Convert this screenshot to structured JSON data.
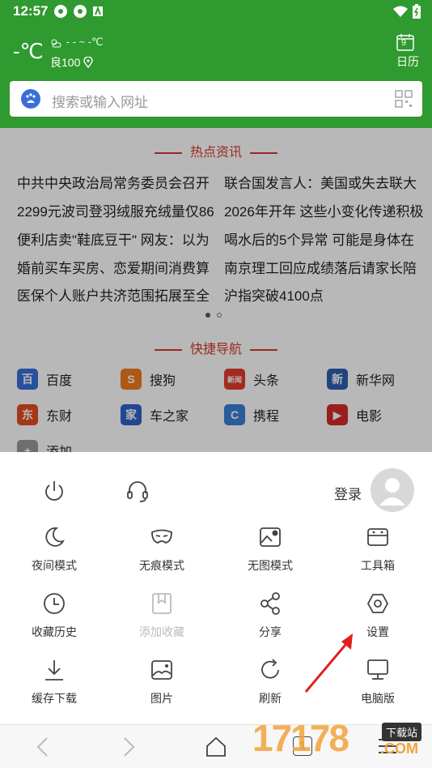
{
  "status_bar": {
    "time": "12:57"
  },
  "weather": {
    "temp": "-℃",
    "detail": "- - ~ -℃",
    "aqi": "良100"
  },
  "calendar": {
    "day": "9",
    "label": "日历"
  },
  "search": {
    "placeholder": "搜索或输入网址"
  },
  "hot_news": {
    "title": "热点资讯",
    "left": [
      "中共中央政治局常务委员会召开",
      "2299元波司登羽绒服充绒量仅86",
      "便利店卖\"鞋底豆干\" 网友：以为",
      "婚前买车买房、恋爱期间消费算",
      "医保个人账户共济范围拓展至全"
    ],
    "right": [
      "联合国发言人：美国或失去联大",
      "2026年开年 这些小变化传递积极",
      "喝水后的5个异常 可能是身体在",
      "南京理工回应成绩落后请家长陪",
      "沪指突破4100点"
    ]
  },
  "quick_nav": {
    "title": "快捷导航",
    "items": [
      {
        "label": "百度",
        "icon": "baidu-icon",
        "color": "#3a6fd8"
      },
      {
        "label": "搜狗",
        "icon": "sogou-icon",
        "color": "#f07a1c"
      },
      {
        "label": "头条",
        "icon": "toutiao-icon",
        "color": "#e23b2e"
      },
      {
        "label": "新华网",
        "icon": "xinhua-icon",
        "color": "#2e5fb0"
      },
      {
        "label": "东财",
        "icon": "dongcai-icon",
        "color": "#e54c20"
      },
      {
        "label": "车之家",
        "icon": "autohome-icon",
        "color": "#2d63c8"
      },
      {
        "label": "携程",
        "icon": "ctrip-icon",
        "color": "#3b7fd6"
      },
      {
        "label": "电影",
        "icon": "movie-icon",
        "color": "#d42a2a"
      },
      {
        "label": "添加",
        "icon": "add-icon",
        "color": "#999999"
      }
    ]
  },
  "menu": {
    "login_label": "登录",
    "items": [
      {
        "label": "夜间模式",
        "icon": "moon-icon"
      },
      {
        "label": "无痕模式",
        "icon": "mask-icon"
      },
      {
        "label": "无图模式",
        "icon": "no-image-icon"
      },
      {
        "label": "工具箱",
        "icon": "toolbox-icon"
      },
      {
        "label": "收藏历史",
        "icon": "clock-icon"
      },
      {
        "label": "添加收藏",
        "icon": "bookmark-icon",
        "disabled": true
      },
      {
        "label": "分享",
        "icon": "share-icon"
      },
      {
        "label": "设置",
        "icon": "settings-icon"
      },
      {
        "label": "缓存下载",
        "icon": "download-icon"
      },
      {
        "label": "图片",
        "icon": "image-icon"
      },
      {
        "label": "刷新",
        "icon": "refresh-icon"
      },
      {
        "label": "电脑版",
        "icon": "desktop-icon"
      }
    ]
  },
  "bottom_bar": {
    "tab_count": "1"
  },
  "watermark": {
    "digits": "17178",
    "badge": "下载站",
    "domain": ".COM"
  },
  "colors": {
    "header_green": "#2f9a2f",
    "accent_red": "#d43b2b",
    "arrow_red": "#e02020"
  }
}
